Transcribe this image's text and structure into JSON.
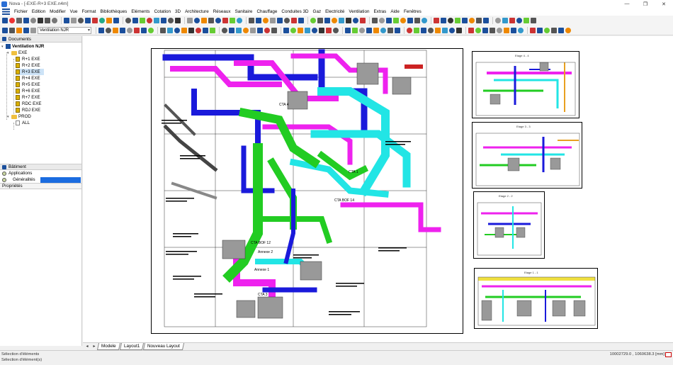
{
  "window": {
    "title": "Nova - [-EXE-R+3 EXE.n4m]",
    "min": "—",
    "restore": "❐",
    "close": "✕"
  },
  "menu": [
    "Fichier",
    "Edition",
    "Modifier",
    "Vue",
    "Format",
    "Bibliothèques",
    "Eléments",
    "Cotation",
    "3D",
    "Architecture",
    "Réseaux",
    "Sanitaire",
    "Chauffage",
    "Conduites 3D",
    "Gaz",
    "Electricité",
    "Ventilation",
    "Extras",
    "Aide",
    "Fenêtres"
  ],
  "toolbar": {
    "layer_combo": "Ventilation NJR",
    "row1_colors": [
      "#1b4f9c",
      "#e33",
      "#666",
      "#1b4f9c",
      "#888",
      "#333",
      "#555",
      "#777",
      "#1b4f9c",
      "#999",
      "#555",
      "#1b4f9c",
      "#c33",
      "#2a8",
      "#e80",
      "#1b4f9c",
      "#555",
      "#1b4f9c",
      "#6c3",
      "#c33",
      "#39c",
      "#1b4f9c",
      "#555",
      "#333",
      "#999",
      "#1b4f9c",
      "#e80",
      "#555",
      "#1b4f9c",
      "#c33",
      "#6c3",
      "#39c",
      "#555",
      "#1b4f9c",
      "#e80",
      "#999",
      "#1b4f9c",
      "#555",
      "#c33",
      "#1b4f9c",
      "#6c3",
      "#555",
      "#1b4f9c",
      "#e80",
      "#39c",
      "#333",
      "#1b4f9c",
      "#c33",
      "#555",
      "#999",
      "#1b4f9c",
      "#6c3",
      "#e80",
      "#1b4f9c",
      "#555",
      "#39c",
      "#c33",
      "#1b4f9c",
      "#333",
      "#6c3",
      "#1b4f9c",
      "#e80",
      "#555",
      "#1b4f9c",
      "#999",
      "#39c",
      "#c33",
      "#1b4f9c",
      "#6c3",
      "#555"
    ],
    "row2_colors": [
      "#1b4f9c",
      "#555",
      "#e80",
      "#1b4f9c",
      "#999",
      "#c33",
      "#1b4f9c",
      "#6c3",
      "#555",
      "#39c",
      "#1b4f9c",
      "#e80",
      "#333",
      "#c33",
      "#1b4f9c",
      "#6c3",
      "#555",
      "#1b4f9c",
      "#39c",
      "#e80",
      "#999",
      "#1b4f9c",
      "#c33",
      "#555",
      "#1b4f9c",
      "#6c3",
      "#e80",
      "#39c",
      "#1b4f9c",
      "#333",
      "#c33",
      "#555",
      "#1b4f9c",
      "#6c3",
      "#999",
      "#1b4f9c",
      "#e80",
      "#39c",
      "#555",
      "#1b4f9c",
      "#c33",
      "#6c3",
      "#1b4f9c",
      "#555",
      "#e80",
      "#39c",
      "#1b4f9c",
      "#333",
      "#c33",
      "#6c3",
      "#1b4f9c",
      "#555",
      "#999",
      "#e80",
      "#1b4f9c",
      "#39c",
      "#c33",
      "#1b4f9c",
      "#6c3",
      "#555",
      "#1b4f9c",
      "#e80"
    ]
  },
  "panel": {
    "documents_header": "Documents",
    "tree": {
      "root": "Ventilation NJR",
      "exe_folder": "EXE",
      "exe_items": [
        "R+1 EXE",
        "R+2 EXE",
        "R+3 EXE",
        "R+4 EXE",
        "R+5 EXE",
        "R+6 EXE",
        "R+7 EXE",
        "RDC EXE",
        "RDJ EXE"
      ],
      "prod_folder": "PROD",
      "prod_items": [
        "ALL"
      ]
    },
    "batiment_header": "Bâtiment",
    "applications_header": "Applications",
    "generalites_label": "Généralités",
    "proprietes_header": "Propriétés"
  },
  "sheets": {
    "s1_label": "Etage 4 - 4",
    "s2_label": "Etage 3 - 3",
    "s3_label": "Etage 2 - 2",
    "s4_label": "Etage 1 - 1",
    "main_labels": [
      "CTA 1",
      "CTA BOF 14",
      "Annexe 1",
      "Annexe 2",
      "CTA BOF 12",
      "CTA 3",
      "CTA 4"
    ]
  },
  "tabs": [
    "Modele",
    "Layout1",
    "Nouveau Layout"
  ],
  "status": {
    "line1": "Sélection d'éléments",
    "line2": "Sélection d'élément(s)",
    "coords": "10002729.0 , 1060638.3 [mm]"
  }
}
